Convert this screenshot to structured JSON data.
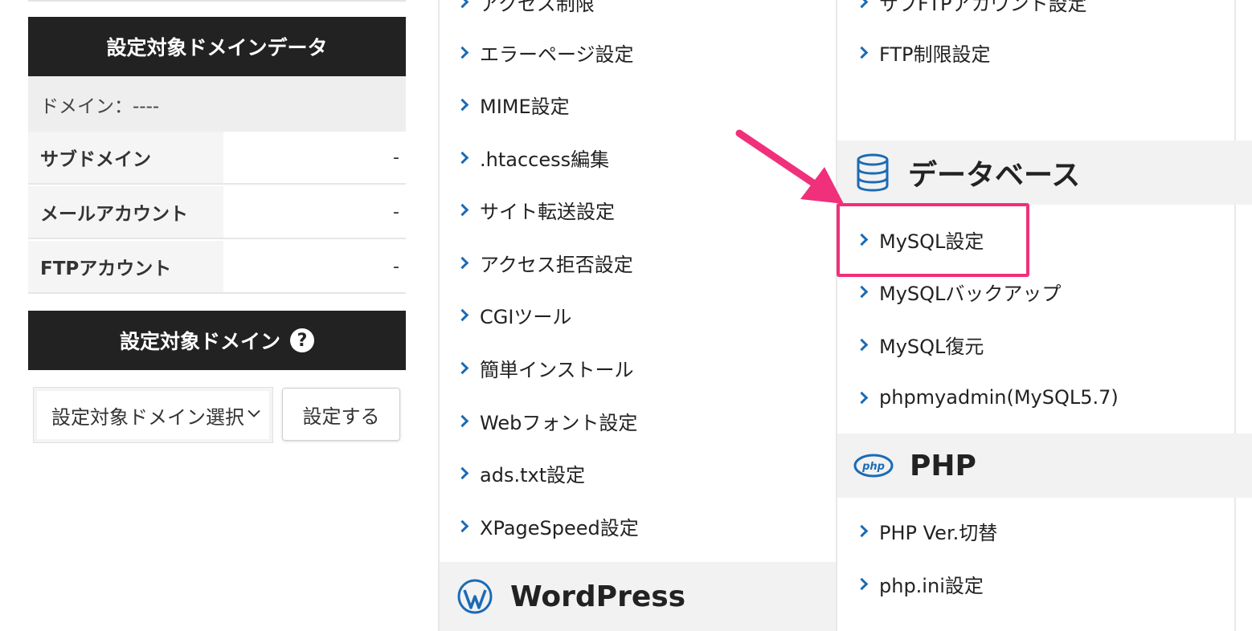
{
  "left_panel": {
    "domain_data_title": "設定対象ドメインデータ",
    "domain_line": "ドメイン：----",
    "stats": [
      {
        "label": "サブドメイン",
        "value": "-"
      },
      {
        "label": "メールアカウント",
        "value": "-"
      },
      {
        "label": "FTPアカウント",
        "value": "-"
      }
    ],
    "target_domain_title": "設定対象ドメイン",
    "help_symbol": "?",
    "select_value": "設定対象ドメイン選択",
    "set_button": "設定する"
  },
  "column_middle": {
    "partial_top_item": "アクセス制限",
    "items": [
      "エラーページ設定",
      "MIME設定",
      ".htaccess編集",
      "サイト転送設定",
      "アクセス拒否設定",
      "CGIツール",
      "簡単インストール",
      "Webフォント設定",
      "ads.txt設定",
      "XPageSpeed設定"
    ],
    "wordpress_section": {
      "title": "WordPress",
      "icon": "wordpress-icon"
    }
  },
  "column_right": {
    "partial_top_item": "サブFTPアカウント設定",
    "ftp_items": [
      "FTP制限設定"
    ],
    "database_section": {
      "title": "データベース",
      "icon": "database-icon",
      "items": [
        "MySQL設定",
        "MySQLバックアップ",
        "MySQL復元",
        "phpmyadmin(MySQL5.7)"
      ]
    },
    "php_section": {
      "title": "PHP",
      "icon": "php-icon",
      "icon_text": "php",
      "items": [
        "PHP Ver.切替",
        "php.ini設定"
      ]
    }
  },
  "annotation": {
    "highlight_color": "#f0307a",
    "highlighted_item": "MySQL設定"
  },
  "colors": {
    "dark_header": "#222222",
    "accent_blue": "#1b6bb5",
    "pink": "#f0307a"
  }
}
